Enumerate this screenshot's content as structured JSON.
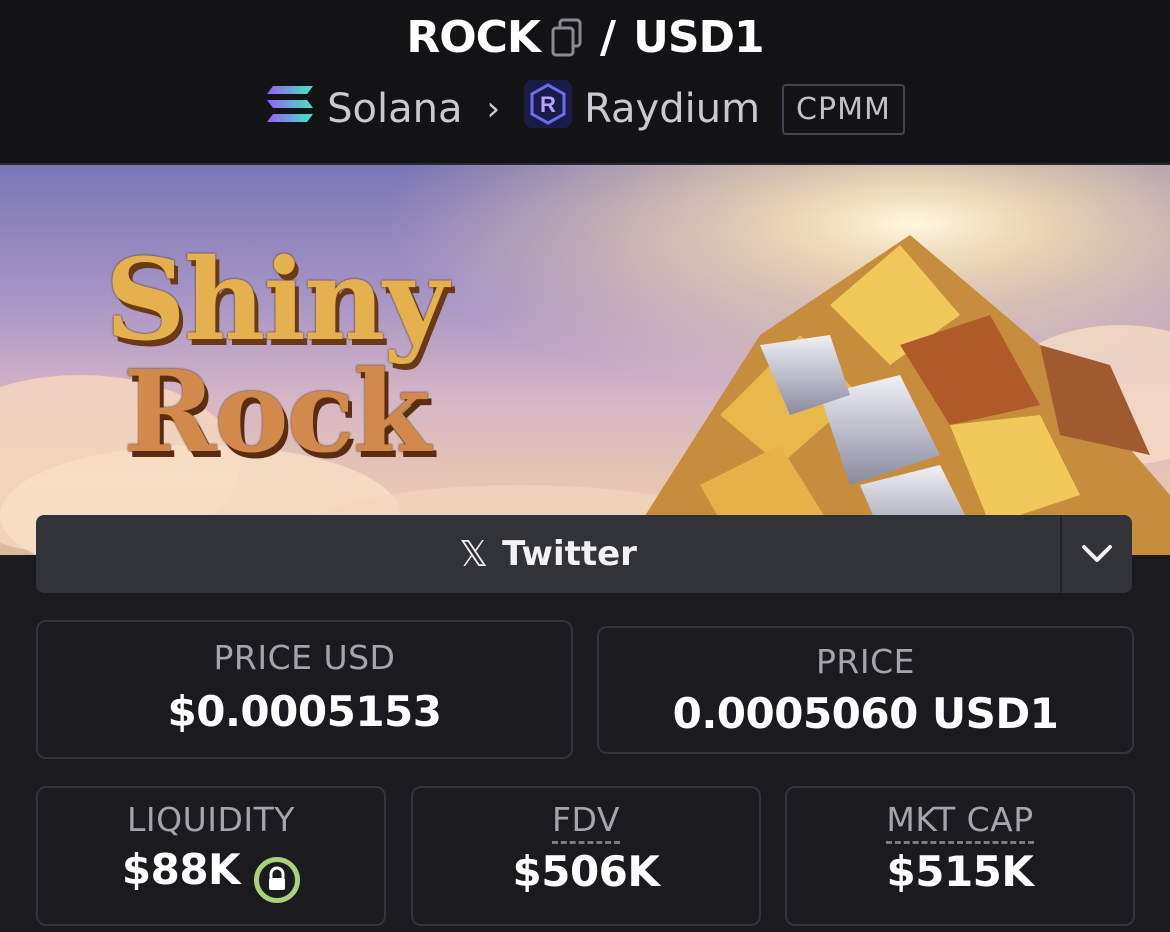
{
  "header": {
    "base_symbol": "ROCK",
    "separator": "/",
    "quote_symbol": "USD1",
    "chain_name": "Solana",
    "chevron": "›",
    "dex_name": "Raydium",
    "pool_type": "CPMM"
  },
  "banner": {
    "title_line1": "Shiny",
    "title_line2": "Rock"
  },
  "social": {
    "twitter_label": "Twitter",
    "x_glyph": "𝕏"
  },
  "stats": {
    "price_usd_label": "PRICE USD",
    "price_usd_value": "$0.0005153",
    "price_label": "PRICE",
    "price_value": "0.0005060 USD1",
    "liquidity_label": "LIQUIDITY",
    "liquidity_value": "$88K",
    "fdv_label": "FDV",
    "fdv_value": "$506K",
    "mktcap_label": "MKT CAP",
    "mktcap_value": "$515K"
  },
  "icons": {
    "copy": "copy-icon",
    "solana": "solana-logo-icon",
    "raydium": "raydium-logo-icon",
    "x": "x-logo-icon",
    "chevron_down": "chevron-down-icon",
    "lock": "lock-icon"
  },
  "colors": {
    "background": "#1a1a1f",
    "header_bg": "#131316",
    "card_border": "#33333d",
    "twitter_bar": "#323239",
    "lock_green": "#a8d27a"
  }
}
